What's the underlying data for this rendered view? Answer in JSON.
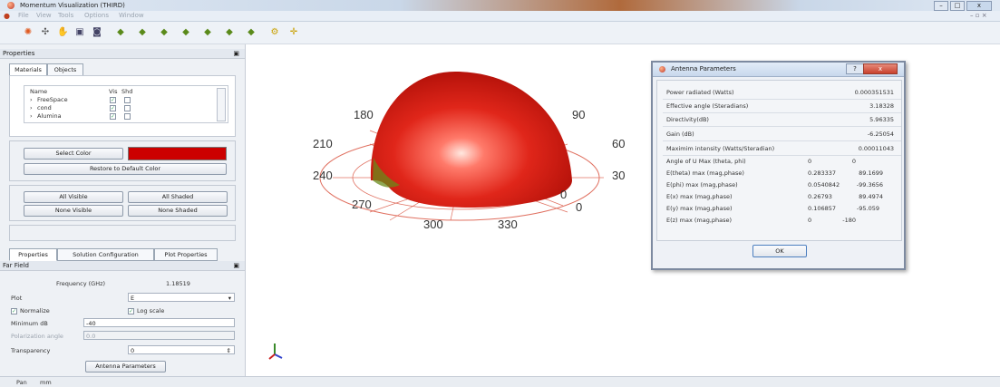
{
  "window": {
    "title": "Momentum Visualization (THIRD)"
  },
  "menu": [
    "File",
    "View",
    "Tools",
    "Options",
    "Window"
  ],
  "properties_dock": {
    "title": "Properties",
    "tabs": [
      "Materials",
      "Objects"
    ],
    "materials_table": {
      "headers": [
        "Name",
        "Vis",
        "Shd"
      ],
      "rows": [
        {
          "name": "FreeSpace",
          "vis": "✓",
          "shd": ""
        },
        {
          "name": "cond",
          "vis": "✓",
          "shd": ""
        },
        {
          "name": "Alumina",
          "vis": "✓",
          "shd": ""
        }
      ]
    },
    "select_color_label": "Select Color",
    "selected_color": "#cc0000",
    "restore_default_label": "Restore to Default Color",
    "all_visible_label": "All Visible",
    "all_shaded_label": "All Shaded",
    "none_visible_label": "None Visible",
    "none_shaded_label": "None Shaded",
    "bottom_tabs": [
      "Properties",
      "Solution Configuration",
      "Plot Properties"
    ]
  },
  "far_field": {
    "title": "Far Field",
    "frequency_label": "Frequency (GHz)",
    "frequency_value": "1.18519",
    "plot_label": "Plot",
    "plot_value": "E",
    "normalize_label": "Normalize",
    "log_scale_label": "Log scale",
    "min_db_label": "Minimum dB",
    "min_db_value": "-40",
    "polarization_label": "Polarization angle",
    "polarization_value": "0.0",
    "transparency_label": "Transparency",
    "transparency_value": "0",
    "antenna_params_button": "Antenna Parameters"
  },
  "plot": {
    "angle_labels": [
      "180",
      "90",
      "210",
      "60",
      "240",
      "30",
      "270",
      "0",
      "300",
      "330",
      "0"
    ],
    "pattern_color": "#cc1a10",
    "grid_color": "#e07060"
  },
  "dialog": {
    "title": "Antenna Parameters",
    "rows": [
      {
        "label": "Power radiated (Watts)",
        "v1": "",
        "v2": "0.000351531"
      },
      {
        "label": "Effective angle (Steradians)",
        "v1": "",
        "v2": "3.18328"
      },
      {
        "label": "Directivity(dB)",
        "v1": "",
        "v2": "5.96335"
      },
      {
        "label": "Gain (dB)",
        "v1": "",
        "v2": "-6.25054"
      },
      {
        "label": "Maximim intensity (Watts/Steradian)",
        "v1": "",
        "v2": "0.00011043"
      },
      {
        "label": "Angle of U Max (theta, phi)",
        "v1": "0",
        "v2": "0"
      },
      {
        "label": "E(theta) max (mag,phase)",
        "v1": "0.283337",
        "v2": "89.1699"
      },
      {
        "label": "E(phi) max (mag,phase)",
        "v1": "0.0540842",
        "v2": "-99.3656"
      },
      {
        "label": "E(x) max (mag,phase)",
        "v1": "0.26793",
        "v2": "89.4974"
      },
      {
        "label": "E(y) max (mag,phase)",
        "v1": "0.106857",
        "v2": "-95.059"
      },
      {
        "label": "E(z) max (mag,phase)",
        "v1": "0",
        "v2": "-180"
      }
    ],
    "ok_label": "OK"
  },
  "statusbar": {
    "left": "Pan",
    "right": "mm"
  }
}
